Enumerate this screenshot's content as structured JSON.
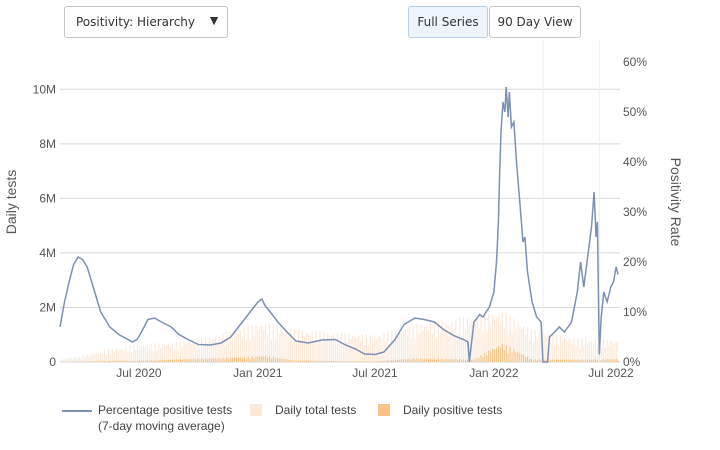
{
  "controls": {
    "dropdown_label": "Positivity: Hierarchy",
    "dropdown_arrow": "▼",
    "full_series_label": "Full Series",
    "ninety_day_label": "90 Day View"
  },
  "colors": {
    "line": "#7b90b3",
    "total_tests": "#fde9d9",
    "positive_tests": "#f6c48a",
    "grid": "#d8d8d8"
  },
  "legend": {
    "line_label_1": "Percentage positive tests",
    "line_label_2": "(7-day moving average)",
    "total_label": "Daily total tests",
    "positive_label": "Daily positive tests"
  },
  "chart_data": {
    "type": "line",
    "title": "",
    "x_ticks": [
      "Jul 2020",
      "Jan 2021",
      "Jul 2021",
      "Jan 2022",
      "Jul 2022"
    ],
    "x_range": [
      "2020-03-01",
      "2022-07-15"
    ],
    "y_left": {
      "label": "Daily tests",
      "ticks": [
        "0",
        "2M",
        "4M",
        "6M",
        "8M",
        "10M"
      ],
      "range": [
        0,
        11000000
      ]
    },
    "y_right": {
      "label": "Positivity Rate",
      "ticks": [
        "0%",
        "10%",
        "20%",
        "30%",
        "40%",
        "50%",
        "60%"
      ],
      "range": [
        0,
        60
      ]
    },
    "grid": "horizontal",
    "legend_position": "bottom",
    "series": [
      {
        "name": "Percentage positive tests (7-day moving average)",
        "axis": "right",
        "points": [
          [
            "2020-03-01",
            7
          ],
          [
            "2020-03-08",
            12
          ],
          [
            "2020-03-15",
            16
          ],
          [
            "2020-03-22",
            19.5
          ],
          [
            "2020-03-29",
            21
          ],
          [
            "2020-04-05",
            20.5
          ],
          [
            "2020-04-12",
            19
          ],
          [
            "2020-04-19",
            16
          ],
          [
            "2020-04-26",
            13
          ],
          [
            "2020-05-03",
            10
          ],
          [
            "2020-05-17",
            7
          ],
          [
            "2020-05-31",
            5.5
          ],
          [
            "2020-06-14",
            4.5
          ],
          [
            "2020-06-21",
            4
          ],
          [
            "2020-06-28",
            4.5
          ],
          [
            "2020-07-05",
            6
          ],
          [
            "2020-07-15",
            8.5
          ],
          [
            "2020-07-25",
            8.8
          ],
          [
            "2020-08-05",
            8
          ],
          [
            "2020-08-20",
            7
          ],
          [
            "2020-09-01",
            5.5
          ],
          [
            "2020-09-15",
            4.5
          ],
          [
            "2020-10-01",
            3.5
          ],
          [
            "2020-10-20",
            3.4
          ],
          [
            "2020-11-05",
            3.8
          ],
          [
            "2020-11-20",
            5
          ],
          [
            "2020-12-05",
            7.5
          ],
          [
            "2020-12-20",
            10
          ],
          [
            "2021-01-01",
            12
          ],
          [
            "2021-01-07",
            12.6
          ],
          [
            "2021-01-12",
            11.3
          ],
          [
            "2021-01-20",
            10
          ],
          [
            "2021-02-01",
            8
          ],
          [
            "2021-02-15",
            6
          ],
          [
            "2021-03-01",
            4.2
          ],
          [
            "2021-03-20",
            3.8
          ],
          [
            "2021-04-10",
            4.4
          ],
          [
            "2021-05-01",
            4.5
          ],
          [
            "2021-05-15",
            3.5
          ],
          [
            "2021-06-01",
            2.6
          ],
          [
            "2021-06-15",
            1.6
          ],
          [
            "2021-07-01",
            1.5
          ],
          [
            "2021-07-15",
            2
          ],
          [
            "2021-08-01",
            4.5
          ],
          [
            "2021-08-15",
            7.5
          ],
          [
            "2021-09-01",
            8.8
          ],
          [
            "2021-09-15",
            8.5
          ],
          [
            "2021-10-01",
            8
          ],
          [
            "2021-10-15",
            6.5
          ],
          [
            "2021-11-01",
            5.2
          ],
          [
            "2021-11-15",
            4.5
          ],
          [
            "2021-11-22",
            4
          ],
          [
            "2021-11-24",
            0
          ],
          [
            "2021-12-01",
            8
          ],
          [
            "2021-12-10",
            9.5
          ],
          [
            "2021-12-15",
            9
          ],
          [
            "2021-12-20",
            10
          ],
          [
            "2021-12-25",
            11
          ],
          [
            "2022-01-01",
            14
          ],
          [
            "2022-01-05",
            20
          ],
          [
            "2022-01-08",
            28
          ],
          [
            "2022-01-10",
            38
          ],
          [
            "2022-01-12",
            46
          ],
          [
            "2022-01-15",
            52
          ],
          [
            "2022-01-18",
            50
          ],
          [
            "2022-01-20",
            55
          ],
          [
            "2022-01-23",
            49
          ],
          [
            "2022-01-25",
            54
          ],
          [
            "2022-01-28",
            47
          ],
          [
            "2022-02-01",
            48
          ],
          [
            "2022-02-05",
            40
          ],
          [
            "2022-02-10",
            32
          ],
          [
            "2022-02-15",
            24
          ],
          [
            "2022-02-18",
            25
          ],
          [
            "2022-02-22",
            18
          ],
          [
            "2022-03-01",
            12
          ],
          [
            "2022-03-08",
            9
          ],
          [
            "2022-03-15",
            8
          ],
          [
            "2022-03-18",
            0
          ],
          [
            "2022-03-25",
            0
          ],
          [
            "2022-03-28",
            5
          ],
          [
            "2022-04-05",
            6
          ],
          [
            "2022-04-12",
            7
          ],
          [
            "2022-04-20",
            6
          ],
          [
            "2022-05-01",
            8
          ],
          [
            "2022-05-10",
            14
          ],
          [
            "2022-05-15",
            20
          ],
          [
            "2022-05-20",
            15
          ],
          [
            "2022-05-25",
            20
          ],
          [
            "2022-06-01",
            27
          ],
          [
            "2022-06-05",
            34
          ],
          [
            "2022-06-08",
            25
          ],
          [
            "2022-06-10",
            28
          ],
          [
            "2022-06-13",
            1.5
          ],
          [
            "2022-06-16",
            9
          ],
          [
            "2022-06-20",
            14
          ],
          [
            "2022-06-25",
            12
          ],
          [
            "2022-07-01",
            15
          ],
          [
            "2022-07-05",
            16
          ],
          [
            "2022-07-09",
            19
          ],
          [
            "2022-07-12",
            17.5
          ]
        ]
      },
      {
        "name": "Daily total tests",
        "axis": "left",
        "style": "bars",
        "envelope": [
          [
            "2020-03-01",
            100000
          ],
          [
            "2020-04-01",
            200000
          ],
          [
            "2020-05-01",
            400000
          ],
          [
            "2020-07-01",
            650000
          ],
          [
            "2020-09-01",
            750000
          ],
          [
            "2020-11-01",
            1000000
          ],
          [
            "2021-01-10",
            1500000
          ],
          [
            "2021-03-01",
            1200000
          ],
          [
            "2021-05-01",
            1100000
          ],
          [
            "2021-07-01",
            1000000
          ],
          [
            "2021-09-01",
            1400000
          ],
          [
            "2021-11-01",
            1600000
          ],
          [
            "2022-01-15",
            1900000
          ],
          [
            "2022-03-01",
            1200000
          ],
          [
            "2022-05-01",
            900000
          ],
          [
            "2022-07-12",
            800000
          ]
        ]
      },
      {
        "name": "Daily positive tests",
        "axis": "left",
        "style": "bars",
        "envelope": [
          [
            "2020-03-01",
            5000
          ],
          [
            "2020-07-01",
            60000
          ],
          [
            "2020-12-20",
            200000
          ],
          [
            "2021-01-10",
            250000
          ],
          [
            "2021-03-01",
            60000
          ],
          [
            "2021-07-01",
            20000
          ],
          [
            "2021-09-01",
            150000
          ],
          [
            "2021-12-01",
            100000
          ],
          [
            "2022-01-12",
            700000
          ],
          [
            "2022-02-01",
            500000
          ],
          [
            "2022-03-01",
            100000
          ],
          [
            "2022-06-01",
            100000
          ],
          [
            "2022-07-12",
            120000
          ]
        ]
      }
    ]
  }
}
